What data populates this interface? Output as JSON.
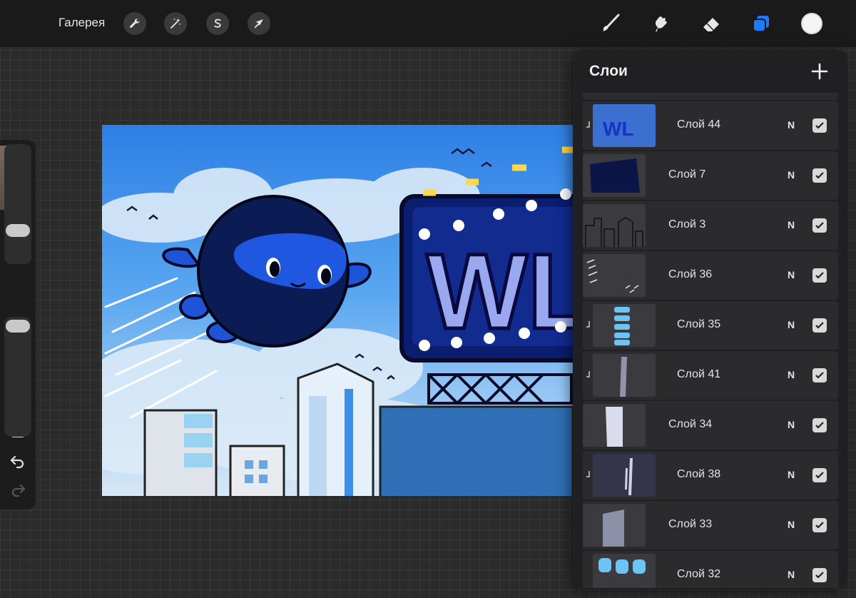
{
  "toolbar": {
    "gallery_label": "Галерея",
    "left_tools": [
      "wrench-icon",
      "magic-wand-icon",
      "selection-s-icon",
      "move-arrow-icon"
    ],
    "right_tools": [
      "brush-icon",
      "smudge-icon",
      "eraser-icon",
      "layers-icon"
    ],
    "active_tool": "layers-icon",
    "current_color": "#f5f5f5",
    "accent_color": "#1e7bff"
  },
  "sidebar": {
    "tab_glyph": "❯",
    "brush_size_level": 0.2,
    "opacity_level": 0.05
  },
  "artwork": {
    "logo_text": "WL"
  },
  "layers_panel": {
    "title": "Слои",
    "add_icon": "plus-icon",
    "layers": [
      {
        "name": "Слой 44",
        "mode": "N",
        "visible": true,
        "clipped": true
      },
      {
        "name": "Слой 7",
        "mode": "N",
        "visible": true,
        "clipped": false
      },
      {
        "name": "Слой 3",
        "mode": "N",
        "visible": true,
        "clipped": false
      },
      {
        "name": "Слой 36",
        "mode": "N",
        "visible": true,
        "clipped": false
      },
      {
        "name": "Слой 35",
        "mode": "N",
        "visible": true,
        "clipped": true
      },
      {
        "name": "Слой 41",
        "mode": "N",
        "visible": true,
        "clipped": true
      },
      {
        "name": "Слой 34",
        "mode": "N",
        "visible": true,
        "clipped": false
      },
      {
        "name": "Слой 38",
        "mode": "N",
        "visible": true,
        "clipped": true
      },
      {
        "name": "Слой 33",
        "mode": "N",
        "visible": true,
        "clipped": false
      },
      {
        "name": "Слой 32",
        "mode": "N",
        "visible": true,
        "clipped": false
      }
    ]
  }
}
